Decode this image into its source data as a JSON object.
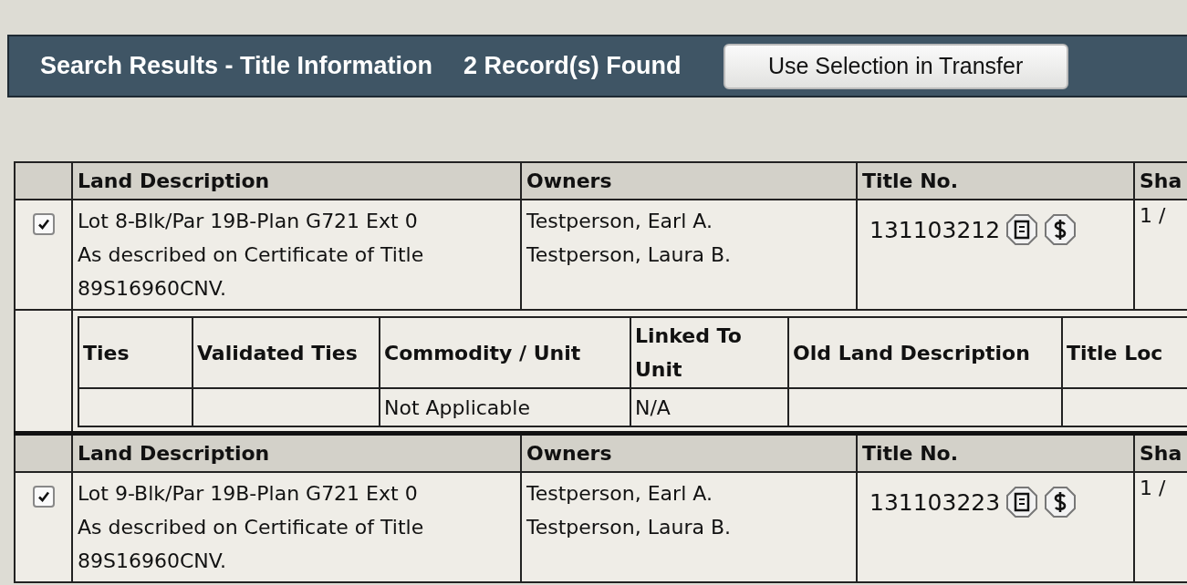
{
  "header": {
    "title": "Search Results - Title Information",
    "count": "2 Record(s) Found",
    "button": "Use Selection in Transfer"
  },
  "records": [
    {
      "checked": true,
      "columns": [
        "Land Description",
        "Owners",
        "Title No.",
        "Sha"
      ],
      "land_description": [
        "Lot 8-Blk/Par 19B-Plan G721 Ext 0",
        "As described on Certificate of Title",
        "89S16960CNV."
      ],
      "owners": [
        "Testperson, Earl A.",
        "Testperson, Laura B."
      ],
      "title_no": "131103212",
      "share": "1 /",
      "details": {
        "columns": [
          "Ties",
          "Validated Ties",
          "Commodity / Unit",
          "Linked To Unit",
          "Old Land Description",
          "Title Loc"
        ],
        "commodity_unit": "Not Applicable",
        "linked_to_unit": "N/A"
      }
    },
    {
      "checked": true,
      "columns": [
        "Land Description",
        "Owners",
        "Title No.",
        "Sha"
      ],
      "land_description": [
        "Lot 9-Blk/Par 19B-Plan G721 Ext 0",
        "As described on Certificate of Title",
        "89S16960CNV."
      ],
      "owners": [
        "Testperson, Earl A.",
        "Testperson, Laura B."
      ],
      "title_no": "131103223",
      "share": "1 /"
    }
  ]
}
